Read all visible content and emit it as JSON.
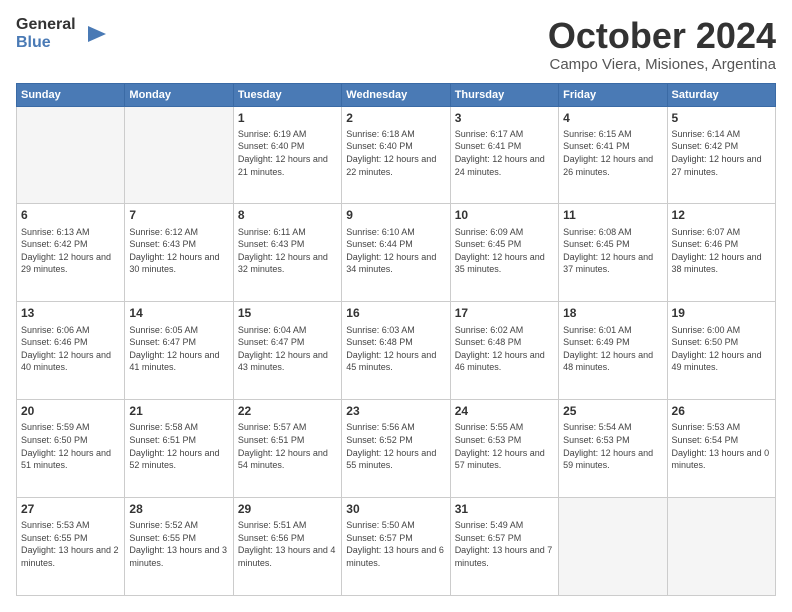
{
  "header": {
    "logo_general": "General",
    "logo_blue": "Blue",
    "title": "October 2024",
    "subtitle": "Campo Viera, Misiones, Argentina"
  },
  "days_of_week": [
    "Sunday",
    "Monday",
    "Tuesday",
    "Wednesday",
    "Thursday",
    "Friday",
    "Saturday"
  ],
  "weeks": [
    [
      {
        "day": "",
        "info": ""
      },
      {
        "day": "",
        "info": ""
      },
      {
        "day": "1",
        "info": "Sunrise: 6:19 AM\nSunset: 6:40 PM\nDaylight: 12 hours and 21 minutes."
      },
      {
        "day": "2",
        "info": "Sunrise: 6:18 AM\nSunset: 6:40 PM\nDaylight: 12 hours and 22 minutes."
      },
      {
        "day": "3",
        "info": "Sunrise: 6:17 AM\nSunset: 6:41 PM\nDaylight: 12 hours and 24 minutes."
      },
      {
        "day": "4",
        "info": "Sunrise: 6:15 AM\nSunset: 6:41 PM\nDaylight: 12 hours and 26 minutes."
      },
      {
        "day": "5",
        "info": "Sunrise: 6:14 AM\nSunset: 6:42 PM\nDaylight: 12 hours and 27 minutes."
      }
    ],
    [
      {
        "day": "6",
        "info": "Sunrise: 6:13 AM\nSunset: 6:42 PM\nDaylight: 12 hours and 29 minutes."
      },
      {
        "day": "7",
        "info": "Sunrise: 6:12 AM\nSunset: 6:43 PM\nDaylight: 12 hours and 30 minutes."
      },
      {
        "day": "8",
        "info": "Sunrise: 6:11 AM\nSunset: 6:43 PM\nDaylight: 12 hours and 32 minutes."
      },
      {
        "day": "9",
        "info": "Sunrise: 6:10 AM\nSunset: 6:44 PM\nDaylight: 12 hours and 34 minutes."
      },
      {
        "day": "10",
        "info": "Sunrise: 6:09 AM\nSunset: 6:45 PM\nDaylight: 12 hours and 35 minutes."
      },
      {
        "day": "11",
        "info": "Sunrise: 6:08 AM\nSunset: 6:45 PM\nDaylight: 12 hours and 37 minutes."
      },
      {
        "day": "12",
        "info": "Sunrise: 6:07 AM\nSunset: 6:46 PM\nDaylight: 12 hours and 38 minutes."
      }
    ],
    [
      {
        "day": "13",
        "info": "Sunrise: 6:06 AM\nSunset: 6:46 PM\nDaylight: 12 hours and 40 minutes."
      },
      {
        "day": "14",
        "info": "Sunrise: 6:05 AM\nSunset: 6:47 PM\nDaylight: 12 hours and 41 minutes."
      },
      {
        "day": "15",
        "info": "Sunrise: 6:04 AM\nSunset: 6:47 PM\nDaylight: 12 hours and 43 minutes."
      },
      {
        "day": "16",
        "info": "Sunrise: 6:03 AM\nSunset: 6:48 PM\nDaylight: 12 hours and 45 minutes."
      },
      {
        "day": "17",
        "info": "Sunrise: 6:02 AM\nSunset: 6:48 PM\nDaylight: 12 hours and 46 minutes."
      },
      {
        "day": "18",
        "info": "Sunrise: 6:01 AM\nSunset: 6:49 PM\nDaylight: 12 hours and 48 minutes."
      },
      {
        "day": "19",
        "info": "Sunrise: 6:00 AM\nSunset: 6:50 PM\nDaylight: 12 hours and 49 minutes."
      }
    ],
    [
      {
        "day": "20",
        "info": "Sunrise: 5:59 AM\nSunset: 6:50 PM\nDaylight: 12 hours and 51 minutes."
      },
      {
        "day": "21",
        "info": "Sunrise: 5:58 AM\nSunset: 6:51 PM\nDaylight: 12 hours and 52 minutes."
      },
      {
        "day": "22",
        "info": "Sunrise: 5:57 AM\nSunset: 6:51 PM\nDaylight: 12 hours and 54 minutes."
      },
      {
        "day": "23",
        "info": "Sunrise: 5:56 AM\nSunset: 6:52 PM\nDaylight: 12 hours and 55 minutes."
      },
      {
        "day": "24",
        "info": "Sunrise: 5:55 AM\nSunset: 6:53 PM\nDaylight: 12 hours and 57 minutes."
      },
      {
        "day": "25",
        "info": "Sunrise: 5:54 AM\nSunset: 6:53 PM\nDaylight: 12 hours and 59 minutes."
      },
      {
        "day": "26",
        "info": "Sunrise: 5:53 AM\nSunset: 6:54 PM\nDaylight: 13 hours and 0 minutes."
      }
    ],
    [
      {
        "day": "27",
        "info": "Sunrise: 5:53 AM\nSunset: 6:55 PM\nDaylight: 13 hours and 2 minutes."
      },
      {
        "day": "28",
        "info": "Sunrise: 5:52 AM\nSunset: 6:55 PM\nDaylight: 13 hours and 3 minutes."
      },
      {
        "day": "29",
        "info": "Sunrise: 5:51 AM\nSunset: 6:56 PM\nDaylight: 13 hours and 4 minutes."
      },
      {
        "day": "30",
        "info": "Sunrise: 5:50 AM\nSunset: 6:57 PM\nDaylight: 13 hours and 6 minutes."
      },
      {
        "day": "31",
        "info": "Sunrise: 5:49 AM\nSunset: 6:57 PM\nDaylight: 13 hours and 7 minutes."
      },
      {
        "day": "",
        "info": ""
      },
      {
        "day": "",
        "info": ""
      }
    ]
  ]
}
